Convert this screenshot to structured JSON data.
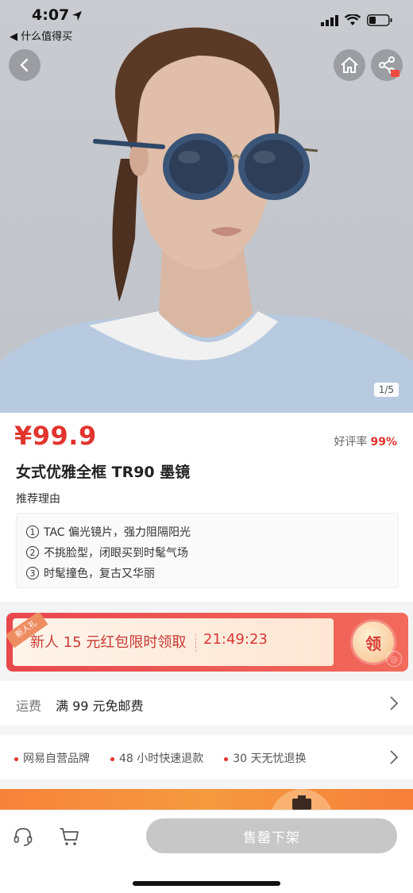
{
  "status_bar": {
    "time": "4:07",
    "back_app": "◀ 什么值得买"
  },
  "gallery": {
    "pager": "1/5"
  },
  "product": {
    "price": "¥99.9",
    "rating_label": "好评率",
    "rating_value": "99%",
    "title": "女式优雅全框 TR90 墨镜",
    "reason_label": "推荐理由",
    "reasons": [
      {
        "num": "1",
        "text": "TAC 偏光镜片，强力阻隔阳光"
      },
      {
        "num": "2",
        "text": "不挑脸型，闭眼买到时髦气场"
      },
      {
        "num": "3",
        "text": "时髦撞色，复古又华丽"
      }
    ]
  },
  "coupon": {
    "ribbon": "新人礼",
    "text": "新人 15 元红包限时领取",
    "timer": "21:49:23",
    "button": "领"
  },
  "shipping": {
    "label": "运费",
    "value": "满 99 元免邮费"
  },
  "service": {
    "items": [
      "网易自营品牌",
      "48 小时快速退款",
      "30 天无忧退换"
    ]
  },
  "bottom_bar": {
    "buy_button": "售罄下架"
  },
  "colors": {
    "accent": "#e1342d",
    "disabled": "#c7c7c7",
    "coupon": "#e9484d"
  },
  "icons": [
    "back-icon",
    "home-icon",
    "share-icon",
    "customer-service-icon",
    "cart-icon",
    "chevron-right-icon",
    "signal-icon",
    "wifi-icon",
    "battery-icon",
    "location-arrow-icon"
  ]
}
